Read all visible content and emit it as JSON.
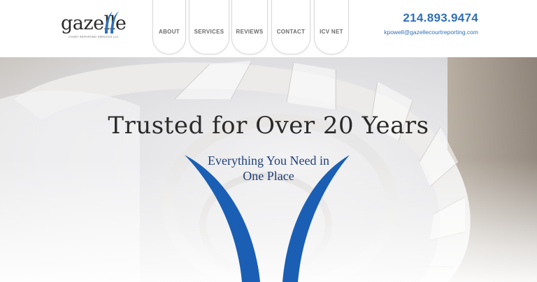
{
  "logo": {
    "wordmark": "gazelle",
    "tagline": "COURT REPORTING SERVICES LLC"
  },
  "nav": {
    "items": [
      {
        "label": "ABOUT"
      },
      {
        "label": "SERVICES"
      },
      {
        "label": "REVIEWS"
      },
      {
        "label": "CONTACT"
      },
      {
        "label": "ICV NET"
      }
    ]
  },
  "contact": {
    "phone": "214.893.9474",
    "email": "kpowell@gazellecourtreporting.com"
  },
  "hero": {
    "title": "Trusted for Over 20 Years",
    "subtitle_line1": "Everything You Need in",
    "subtitle_line2": "One Place"
  },
  "colors": {
    "brand_blue": "#2f6fb9",
    "swoosh_blue": "#1a5fb4",
    "subtitle_navy": "#1f3f7a",
    "nav_text": "#6b6b6b"
  },
  "icons": {
    "logo_mark": "gazelle-horns-icon"
  }
}
